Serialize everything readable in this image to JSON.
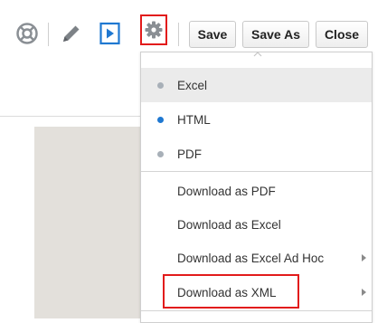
{
  "toolbar": {
    "help_icon": "lifebuoy-icon",
    "edit_icon": "pencil-icon",
    "run_icon": "play-icon",
    "settings_icon": "gear-icon",
    "save_label": "Save",
    "save_as_label": "Save As",
    "close_label": "Close"
  },
  "menu": {
    "formats": [
      {
        "label": "Excel",
        "selected": true,
        "dot_color": "#a8b0b8"
      },
      {
        "label": "HTML",
        "selected": false,
        "dot_color": "#1f78d1"
      },
      {
        "label": "PDF",
        "selected": false,
        "dot_color": "#a8b0b8"
      }
    ],
    "downloads": [
      {
        "label": "Download as PDF",
        "has_submenu": false
      },
      {
        "label": "Download as Excel",
        "has_submenu": false
      },
      {
        "label": "Download as Excel Ad Hoc",
        "has_submenu": true
      },
      {
        "label": "Download as XML",
        "has_submenu": true
      }
    ]
  },
  "colors": {
    "highlight_red": "#e21b1b",
    "accent_blue": "#1f78d1",
    "icon_grey": "#8a8f94"
  }
}
